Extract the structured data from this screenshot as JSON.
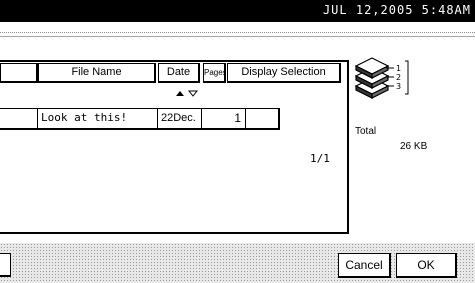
{
  "status_bar": {
    "datetime": "JUL 12,2005 5:48AM"
  },
  "list": {
    "headers": {
      "file_name": "File Name",
      "date": "Date",
      "pages": "Pages",
      "display_selection": "Display Selection"
    },
    "rows": [
      {
        "file_name": "Look at this!",
        "date": "22Dec.",
        "pages": "1"
      }
    ],
    "page_indicator": "1/1"
  },
  "summary": {
    "stack_labels": [
      "1",
      "2",
      "3"
    ],
    "total_label": "Total",
    "size": "26 KB"
  },
  "buttons": {
    "cancel": "Cancel",
    "ok": "OK"
  }
}
